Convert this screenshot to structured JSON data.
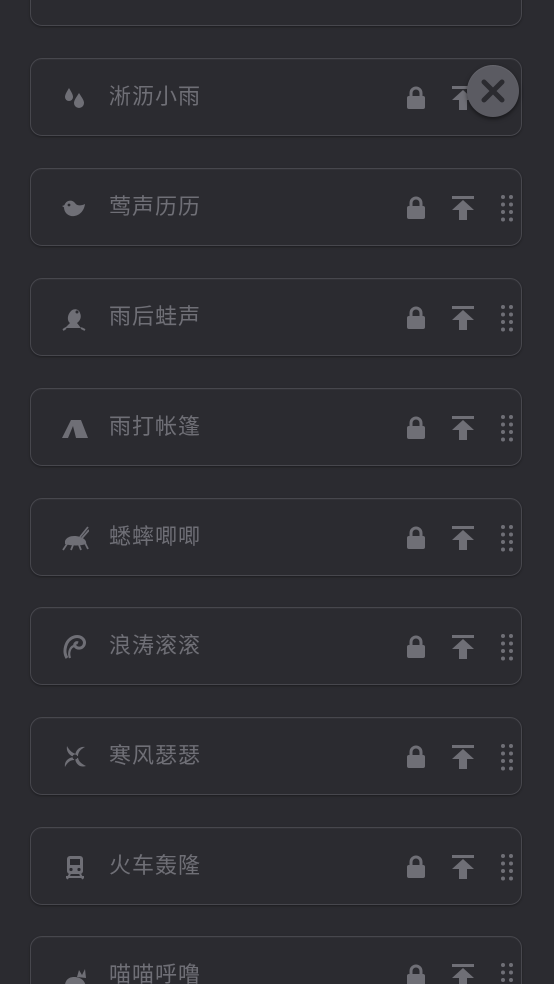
{
  "colors": {
    "background": "#2b2b30",
    "card_border": "#47474d",
    "icon": "#6f6f76",
    "label": "#6f6f76",
    "close_bg": "#5b5b62",
    "close_glyph": "#2b2b30"
  },
  "sounds": [
    {
      "label": "",
      "icon": "partial-icon"
    },
    {
      "label": "淅沥小雨",
      "icon": "raindrops-icon"
    },
    {
      "label": "莺声历历",
      "icon": "bird-icon"
    },
    {
      "label": "雨后蛙声",
      "icon": "frog-icon"
    },
    {
      "label": "雨打帐篷",
      "icon": "tent-icon"
    },
    {
      "label": "蟋蟀唧唧",
      "icon": "cricket-icon"
    },
    {
      "label": "浪涛滚滚",
      "icon": "wave-icon"
    },
    {
      "label": "寒风瑟瑟",
      "icon": "wind-icon"
    },
    {
      "label": "火车轰隆",
      "icon": "train-icon"
    },
    {
      "label": "喵喵呼噜",
      "icon": "cat-icon"
    }
  ],
  "controls": {
    "lock_icon": "lock-icon",
    "pin_icon": "pin-to-top-icon",
    "drag_icon": "drag-handle-icon",
    "close_icon": "close-icon"
  }
}
